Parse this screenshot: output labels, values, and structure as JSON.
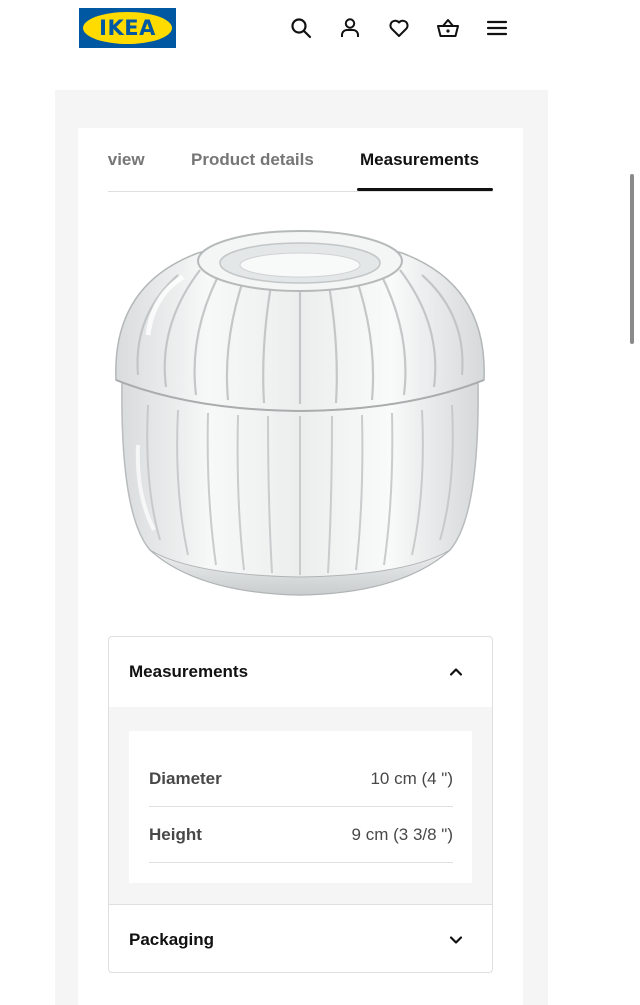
{
  "header": {
    "logo_text": "IKEA",
    "icons": [
      "search-icon",
      "profile-icon",
      "heart-icon",
      "basket-icon",
      "menu-icon"
    ],
    "brand_colors": {
      "blue": "#0058a3",
      "yellow": "#ffdb00"
    }
  },
  "tabs": [
    {
      "label": "Overview"
    },
    {
      "label": "Product details"
    },
    {
      "label": "Measurements",
      "active": true
    }
  ],
  "accordion": {
    "measurements": {
      "title": "Measurements",
      "expanded": true,
      "rows": [
        {
          "label": "Diameter",
          "value": "10 cm (4 \")"
        },
        {
          "label": "Height",
          "value": "9 cm (3 3/8 \")"
        }
      ]
    },
    "packaging": {
      "title": "Packaging",
      "expanded": false
    }
  }
}
